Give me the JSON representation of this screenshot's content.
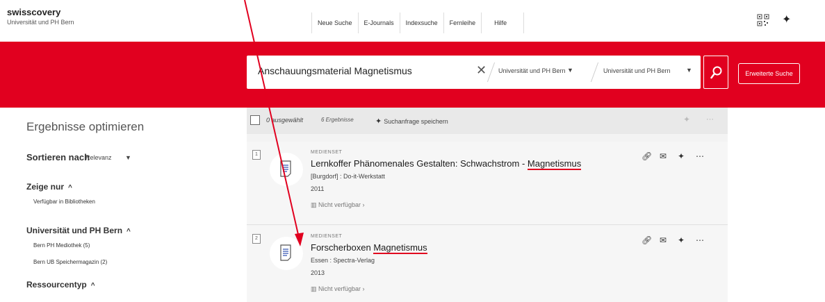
{
  "header": {
    "brand": "swisscovery",
    "brand_sub": "Universität und PH Bern",
    "nav": [
      "Neue Suche",
      "E-Journals",
      "Indexsuche",
      "Fernleihe",
      "Hilfe"
    ]
  },
  "search": {
    "query": "Anschauungsmaterial Magnetismus",
    "scope1": "Universität und PH Bern",
    "scope2": "Universität und PH Bern",
    "advanced_label": "Erweiterte Suche"
  },
  "facets": {
    "title": "Ergebnisse optimieren",
    "sort_label": "Sortieren nach",
    "sort_value": "Relevanz",
    "groups": [
      {
        "label": "Zeige nur",
        "items": [
          "Verfügbar in Bibliotheken"
        ]
      },
      {
        "label": "Universität und PH Bern",
        "items": [
          "Bern PH Mediothek (5)",
          "Bern UB Speichermagazin (2)"
        ]
      },
      {
        "label": "Ressourcentyp",
        "items": []
      }
    ]
  },
  "toolbar": {
    "selected": "0 ausgewählt",
    "count": "6 Ergebnisse",
    "save_query": "Suchanfrage speichern"
  },
  "records": [
    {
      "num": "1",
      "type": "MEDIENSET",
      "title_pre": "Lernkoffer Phänomenales Gestalten: Schwachstrom - ",
      "title_hl": "Magnetismus",
      "publisher": "[Burgdorf] : Do-it-Werkstatt",
      "year": "2011",
      "availability": "Nicht verfügbar"
    },
    {
      "num": "2",
      "type": "MEDIENSET",
      "title_pre": "Forscherboxen ",
      "title_hl": "Magnetismus",
      "publisher": "Essen : Spectra-Verlag",
      "year": "2013",
      "availability": "Nicht verfügbar"
    }
  ],
  "colors": {
    "brand_red": "#e1001f",
    "annotation_arrow": "#e1001f"
  }
}
